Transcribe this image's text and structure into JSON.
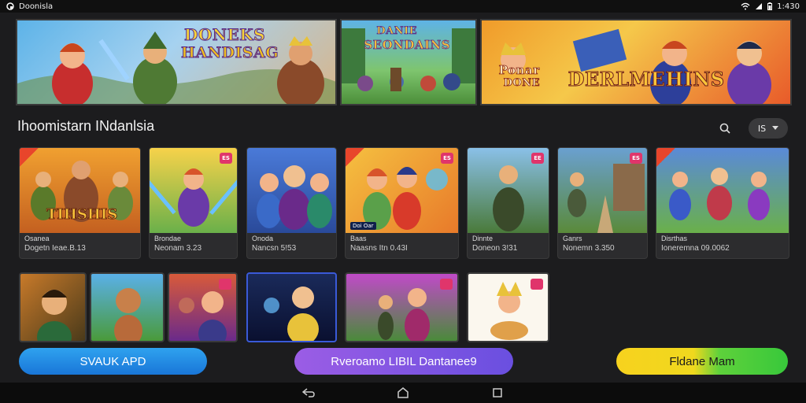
{
  "status_bar": {
    "app_name": "Doonisla",
    "time": "1:430"
  },
  "banners": [
    {
      "title_line1": "DONEKS",
      "title_line2": "HANDISAG"
    },
    {
      "title_line1": "DANIE",
      "title_line2": "SEONDAINS"
    },
    {
      "title_line1": "Ponar",
      "title_line2": "DONE",
      "title_line3": "DERLMEHINS"
    }
  ],
  "section": {
    "title": "Ihoomistarn INdanlsia",
    "filter_label": "IS"
  },
  "cards": [
    {
      "art_title": "TIHSHIS",
      "name": "Osanea",
      "meta": "Dogetn  Ieae.B.13",
      "badge": ""
    },
    {
      "name": "Brondae",
      "meta": "Neonam  3.23",
      "badge": "ES"
    },
    {
      "name": "Onoda",
      "meta": "Nancsn  5!53",
      "badge": ""
    },
    {
      "name": "Baas",
      "meta": "Naasns Itn  0.43I",
      "badge": "ES",
      "tag": "Doi Oar"
    },
    {
      "name": "Dinnte",
      "meta": "Doneon  3!31",
      "badge": "EE"
    },
    {
      "name": "Ganrs",
      "meta": "Nonemn  3.350",
      "badge": "ES"
    },
    {
      "name": "Disrthas",
      "meta": "Ioneremna  09.0062",
      "badge": ""
    }
  ],
  "buttons": {
    "left": "SVAUK APD",
    "mid": "Rveroamo LIBIL Dantanee9",
    "right": "Fldane Mam"
  },
  "colors": {
    "accent_blue": "#1976d8",
    "accent_purple": "#7a50e3",
    "accent_yellow": "#f7d21e",
    "accent_green": "#38c83b",
    "badge_pink": "#e0356b"
  }
}
